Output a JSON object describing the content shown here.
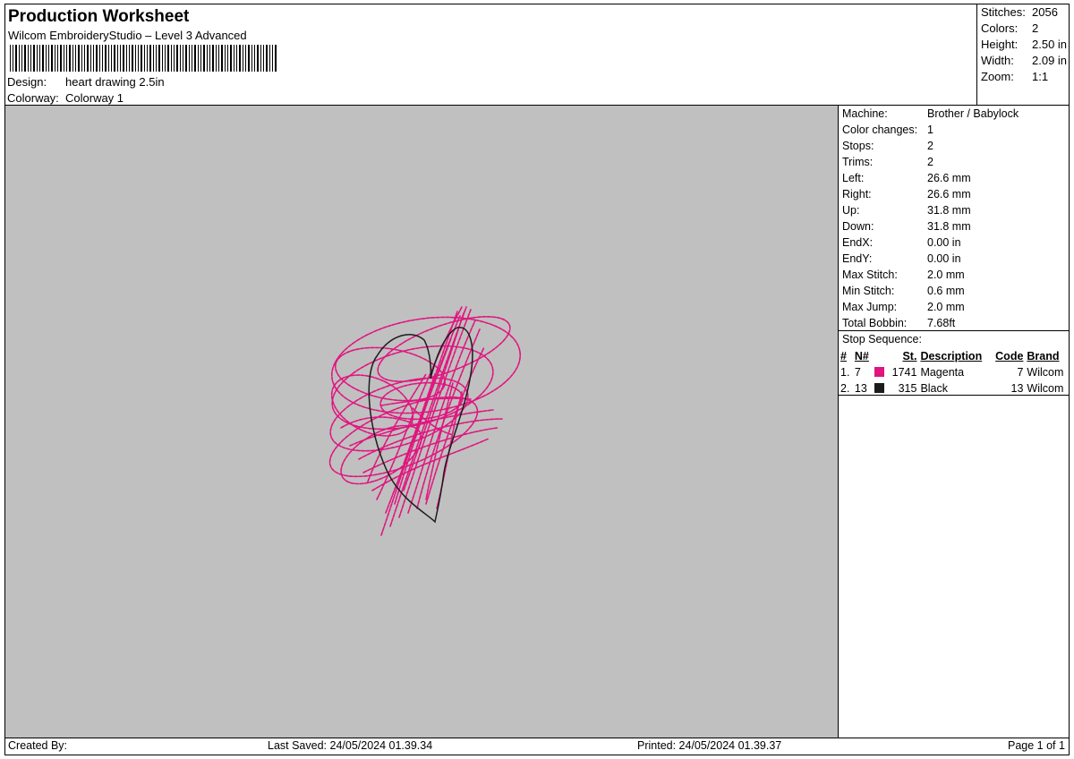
{
  "header": {
    "title": "Production Worksheet",
    "subtitle": "Wilcom EmbroideryStudio – Level 3 Advanced",
    "design_label": "Design:",
    "design_value": "heart drawing 2.5in",
    "colorway_label": "Colorway:",
    "colorway_value": "Colorway 1"
  },
  "stats": [
    {
      "label": "Stitches:",
      "value": "2056"
    },
    {
      "label": "Colors:",
      "value": "2"
    },
    {
      "label": "Height:",
      "value": "2.50 in"
    },
    {
      "label": "Width:",
      "value": "2.09 in"
    },
    {
      "label": "Zoom:",
      "value": "1:1"
    }
  ],
  "machine_info": [
    {
      "label": "Machine:",
      "value": "Brother / Babylock"
    },
    {
      "label": "Color changes:",
      "value": "1"
    },
    {
      "label": "Stops:",
      "value": "2"
    },
    {
      "label": "Trims:",
      "value": "2"
    },
    {
      "label": "Left:",
      "value": "26.6 mm"
    },
    {
      "label": "Right:",
      "value": "26.6 mm"
    },
    {
      "label": "Up:",
      "value": "31.8 mm"
    },
    {
      "label": "Down:",
      "value": "31.8 mm"
    },
    {
      "label": "EndX:",
      "value": "0.00 in"
    },
    {
      "label": "EndY:",
      "value": "0.00 in"
    },
    {
      "label": "Max Stitch:",
      "value": "2.0 mm"
    },
    {
      "label": "Min Stitch:",
      "value": "0.6 mm"
    },
    {
      "label": "Max Jump:",
      "value": "2.0 mm"
    },
    {
      "label": "Total Bobbin:",
      "value": "7.68ft"
    }
  ],
  "stop_sequence": {
    "title": "Stop Sequence:",
    "headers": {
      "index": "#",
      "needle": "N#",
      "stitches": "St.",
      "description": "Description",
      "code": "Code",
      "brand": "Brand"
    },
    "rows": [
      {
        "index": "1.",
        "needle": "7",
        "color": "#e0157f",
        "stitches": "1741",
        "description": "Magenta",
        "code": "7",
        "brand": "Wilcom"
      },
      {
        "index": "2.",
        "needle": "13",
        "color": "#1c1c1c",
        "stitches": "315",
        "description": "Black",
        "code": "13",
        "brand": "Wilcom"
      }
    ]
  },
  "footer": {
    "created_by": "Created By:",
    "last_saved": "Last Saved: 24/05/2024 01.39.34",
    "printed": "Printed: 24/05/2024 01.39.37",
    "page": "Page 1 of 1"
  },
  "colors": {
    "preview_background": "#c0c0c0",
    "magenta_thread": "#e0157f",
    "black_thread": "#1c1c1c"
  }
}
